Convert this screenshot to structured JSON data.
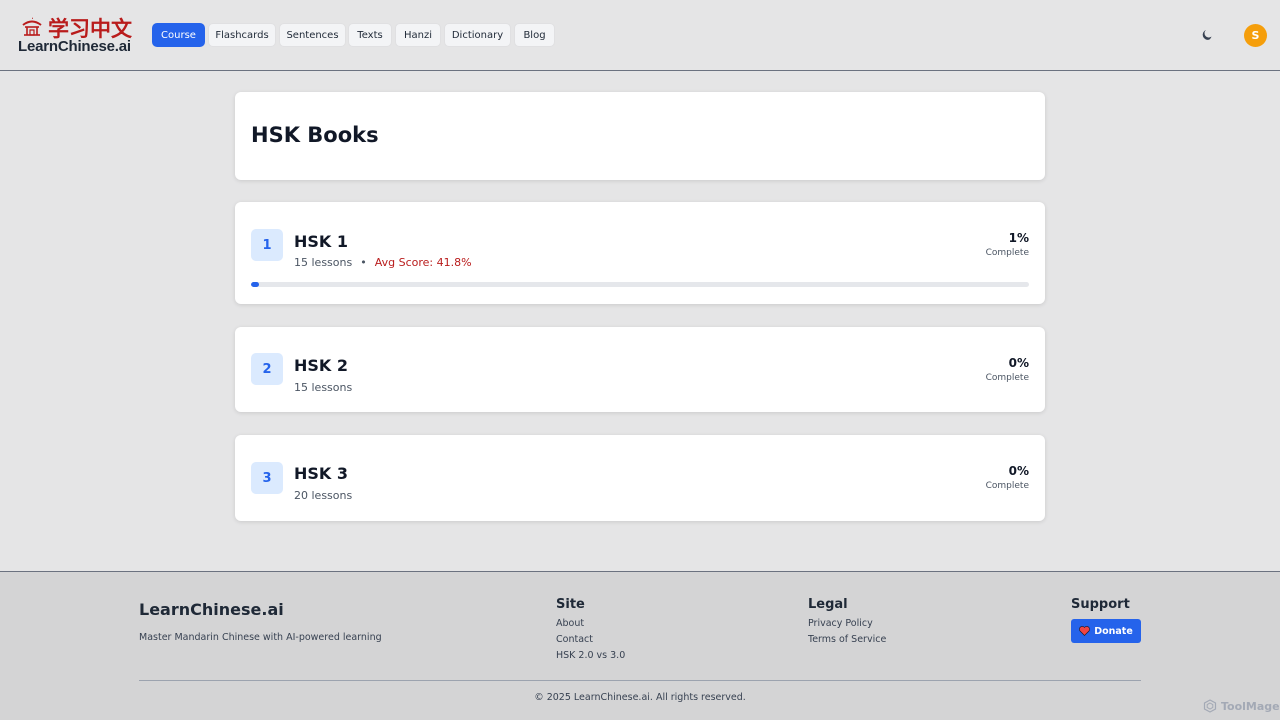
{
  "header": {
    "logo_cn": "学习中文",
    "logo_en": "LearnChinese.ai",
    "nav": [
      {
        "label": "Course",
        "active": true
      },
      {
        "label": "Flashcards",
        "active": false
      },
      {
        "label": "Sentences",
        "active": false
      },
      {
        "label": "Texts",
        "active": false
      },
      {
        "label": "Hanzi",
        "active": false
      },
      {
        "label": "Dictionary",
        "active": false
      },
      {
        "label": "Blog",
        "active": false
      }
    ],
    "theme_icon": "moon-icon",
    "avatar_letter": "S"
  },
  "main": {
    "title": "HSK Books",
    "books": [
      {
        "number": "1",
        "title": "HSK 1",
        "lessons": "15 lessons",
        "separator": "•",
        "avg_score": "Avg Score: 41.8%",
        "percent": "1%",
        "status": "Complete",
        "progress": 0.01
      },
      {
        "number": "2",
        "title": "HSK 2",
        "lessons": "15 lessons",
        "percent": "0%",
        "status": "Complete"
      },
      {
        "number": "3",
        "title": "HSK 3",
        "lessons": "20 lessons",
        "percent": "0%",
        "status": "Complete"
      }
    ]
  },
  "footer": {
    "brand": "LearnChinese.ai",
    "tagline": "Master Mandarin Chinese with AI-powered learning",
    "site": {
      "heading": "Site",
      "links": [
        "About",
        "Contact",
        "HSK 2.0 vs 3.0"
      ]
    },
    "legal": {
      "heading": "Legal",
      "links": [
        "Privacy Policy",
        "Terms of Service"
      ]
    },
    "support": {
      "heading": "Support",
      "donate_label": "Donate"
    },
    "copyright": "© 2025 LearnChinese.ai. All rights reserved."
  },
  "watermark": "ToolMage",
  "colors": {
    "accent": "#2563eb",
    "brand_red": "#b91c1c",
    "avatar": "#f59e0b",
    "page_bg": "#e5e5e6",
    "footer_bg": "#d4d4d5"
  }
}
